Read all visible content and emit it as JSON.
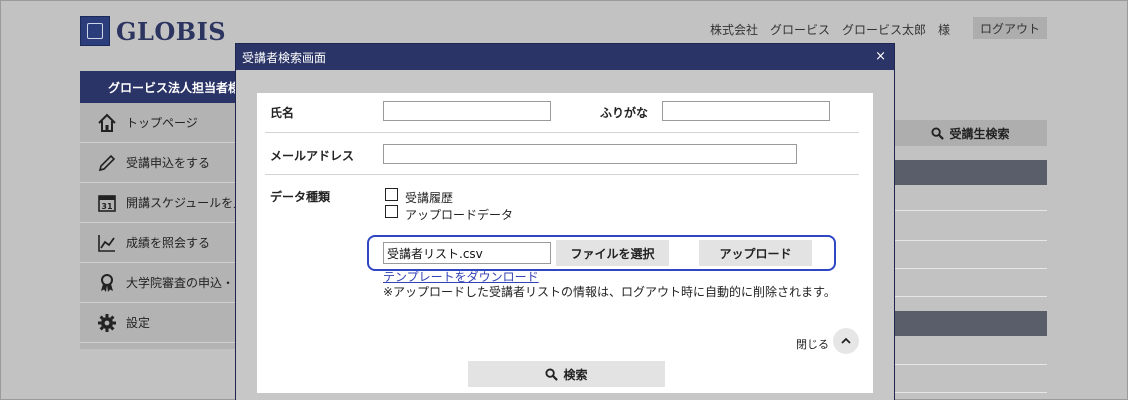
{
  "header": {
    "logo_text": "GLOBIS",
    "user_info": "株式会社　グロービス　グロービス太郎　様",
    "logout_label": "ログアウト"
  },
  "sidebar": {
    "title": "グロービス法人担当者様",
    "items": [
      {
        "label": "トップページ",
        "icon": "home-icon"
      },
      {
        "label": "受講申込をする",
        "icon": "pencil-icon"
      },
      {
        "label": "開講スケジュールを見る",
        "icon": "calendar-icon"
      },
      {
        "label": "成績を照会する",
        "icon": "chart-icon"
      },
      {
        "label": "大学院審査の申込・閲覧",
        "icon": "award-icon"
      },
      {
        "label": "設定",
        "icon": "gear-icon"
      }
    ]
  },
  "right_panel": {
    "search_label": "受講生検索"
  },
  "modal": {
    "title": "受講者検索画面",
    "close_symbol": "×",
    "name_label": "氏名",
    "name_value": "",
    "furigana_label": "ふりがな",
    "furigana_value": "",
    "email_label": "メールアドレス",
    "email_value": "",
    "data_type_label": "データ種類",
    "checkbox_history": "受講履歴",
    "checkbox_upload": "アップロードデータ",
    "file_name": "受講者リスト.csv",
    "choose_file_label": "ファイルを選択",
    "upload_label": "アップロード",
    "template_link": "テンプレートをダウンロード",
    "note": "※アップロードした受講者リストの情報は、ログアウト時に自動的に削除されます。",
    "collapse_label": "閉じる",
    "search_label": "検索"
  },
  "colors": {
    "navy": "#2a3466",
    "highlight": "#3047c4",
    "link": "#3342b5"
  }
}
